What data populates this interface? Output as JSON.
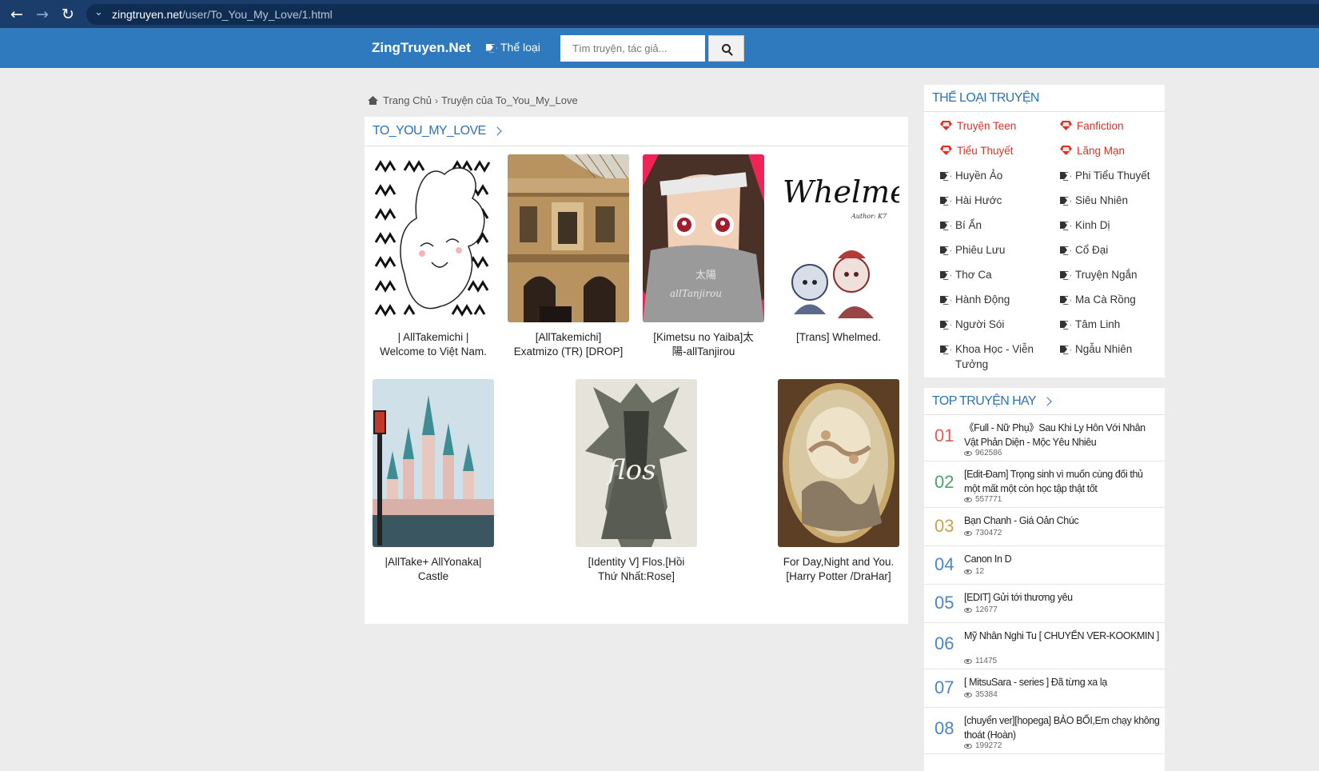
{
  "browser": {
    "url_host": "zingtruyen.net",
    "url_path": "/user/To_You_My_Love/1.html"
  },
  "header": {
    "brand": "ZingTruyen.Net",
    "genre_label": "Thể loại",
    "search_placeholder": "Tìm truyện, tác giả..."
  },
  "breadcrumb": {
    "home": "Trang Chủ",
    "current": "Truyện của To_You_My_Love"
  },
  "main": {
    "section_title": "TO_YOU_MY_LOVE",
    "stories": [
      {
        "title": "| AllTakemichi | Welcome to Việt Nam."
      },
      {
        "title": "[AllTakemichi] Exatmizo (TR) [DROP]"
      },
      {
        "title": "[Kimetsu no Yaiba]太陽-allTanjirou"
      },
      {
        "title": "[Trans] Whelmed."
      },
      {
        "title": "|AllTake+ AllYonaka| Castle"
      },
      {
        "title": "[Identity V] Flos.[Hồi Thứ Nhất:Rose]"
      },
      {
        "title": "For Day,Night and You.[Harry Potter /DraHar]"
      }
    ],
    "cover_texts": {
      "whelmed_title": "Whelmed",
      "whelmed_author": "Author: K7",
      "kimetsu_sun": "太陽",
      "kimetsu_name": "allTanjirou",
      "flos": "flos"
    }
  },
  "sidebar": {
    "genres_title": "THỂ LOẠI TRUYỆN",
    "genres": [
      {
        "label": "Truyện Teen",
        "hot": true
      },
      {
        "label": "Fanfiction",
        "hot": true
      },
      {
        "label": "Tiểu Thuyết",
        "hot": true
      },
      {
        "label": "Lãng Mạn",
        "hot": true
      },
      {
        "label": "Huyền Ảo",
        "hot": false
      },
      {
        "label": "Phi Tiểu Thuyết",
        "hot": false
      },
      {
        "label": "Hài Hước",
        "hot": false
      },
      {
        "label": "Siêu Nhiên",
        "hot": false
      },
      {
        "label": "Bí Ẩn",
        "hot": false
      },
      {
        "label": "Kinh Dị",
        "hot": false
      },
      {
        "label": "Phiêu Lưu",
        "hot": false
      },
      {
        "label": "Cổ Đại",
        "hot": false
      },
      {
        "label": "Thơ Ca",
        "hot": false
      },
      {
        "label": "Truyện Ngắn",
        "hot": false
      },
      {
        "label": "Hành Động",
        "hot": false
      },
      {
        "label": "Ma Cà Rồng",
        "hot": false
      },
      {
        "label": "Người Sói",
        "hot": false
      },
      {
        "label": "Tâm Linh",
        "hot": false
      },
      {
        "label": "Khoa Học - Viễn Tưởng",
        "hot": false
      },
      {
        "label": "Ngẫu Nhiên",
        "hot": false
      }
    ],
    "top_title": "TOP TRUYỆN HAY",
    "top": [
      {
        "rank": "01",
        "name": "《Full - Nữ Phụ》Sau Khi Ly Hôn Với Nhân Vật Phản Diện - Mộc Yêu Nhiêu",
        "views": "962586",
        "color": "#e05a5a"
      },
      {
        "rank": "02",
        "name": "[Edit-Đam] Trọng sinh vì muốn cùng đối thủ một mất một còn học tập thật tốt",
        "views": "557771",
        "color": "#4aa36b"
      },
      {
        "rank": "03",
        "name": "Bạn Chanh - Giá Oản Chúc",
        "views": "730472",
        "color": "#c9a24a"
      },
      {
        "rank": "04",
        "name": "Canon In D",
        "views": "12",
        "color": "#4a86c9"
      },
      {
        "rank": "05",
        "name": "[EDIT] Gửi tới thương yêu",
        "views": "12677",
        "color": "#4a86c9"
      },
      {
        "rank": "06",
        "name": "Mỹ Nhân Nghi Tu [ CHUYỂN VER-KOOKMIN ]",
        "views": "11475",
        "color": "#4a86c9"
      },
      {
        "rank": "07",
        "name": "[ MitsuSara - series ] Đã từng xa lạ",
        "views": "35384",
        "color": "#4a86c9"
      },
      {
        "rank": "08",
        "name": "[chuyển ver][hopega] BẢO BỐI,Em chạy không thoát (Hoàn)",
        "views": "199272",
        "color": "#4a86c9"
      }
    ]
  }
}
